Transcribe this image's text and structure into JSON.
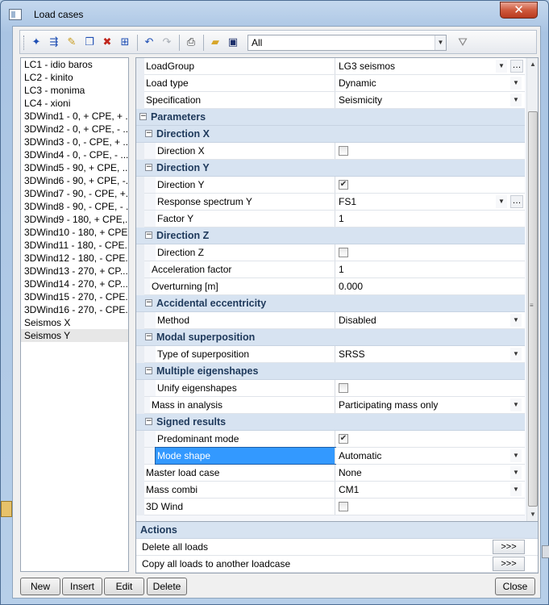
{
  "window": {
    "title": "Load cases",
    "close_glyph": "✕"
  },
  "toolbar": {
    "filter_value": "All",
    "icons": [
      "new-case-icon",
      "insert-icon",
      "edit-icon",
      "copy-icon",
      "delete-icon",
      "tree-icon",
      "undo-icon",
      "redo-icon",
      "print-icon",
      "open-icon",
      "save-icon",
      "filter-icon"
    ]
  },
  "cases": [
    "LC1 - idio  baros",
    "LC2 - kinito",
    "LC3 - monima",
    "LC4 - xioni",
    "3DWind1 - 0, + CPE, + ...",
    "3DWind2 - 0, + CPE, - ...",
    "3DWind3 - 0, - CPE, + ...",
    "3DWind4 - 0, - CPE, - ...",
    "3DWind5 - 90, + CPE, ...",
    "3DWind6 - 90, + CPE, -...",
    "3DWind7 - 90, - CPE, +...",
    "3DWind8 - 90, - CPE, - ...",
    "3DWind9 - 180, + CPE,...",
    "3DWind10 - 180, + CPE...",
    "3DWind11 - 180, - CPE...",
    "3DWind12 - 180, - CPE...",
    "3DWind13 - 270, + CP...",
    "3DWind14 - 270, + CP...",
    "3DWind15 - 270, - CPE...",
    "3DWind16 - 270, - CPE...",
    "Seismos X",
    "Seismos Y"
  ],
  "selected_case_index": 21,
  "properties": [
    {
      "kind": "row",
      "indent": 0,
      "name": "LoadGroup",
      "value": "LG3  seismos",
      "dropdown": true,
      "dots": true
    },
    {
      "kind": "row",
      "indent": 0,
      "name": "Load type",
      "value": "Dynamic",
      "dropdown": true
    },
    {
      "kind": "row",
      "indent": 0,
      "name": "Specification",
      "value": "Seismicity",
      "dropdown": true
    },
    {
      "kind": "section",
      "indent": 0,
      "name": "Parameters"
    },
    {
      "kind": "section",
      "indent": 1,
      "name": "Direction X"
    },
    {
      "kind": "row",
      "indent": 2,
      "name": "Direction X",
      "checkbox": false
    },
    {
      "kind": "section",
      "indent": 1,
      "name": "Direction Y"
    },
    {
      "kind": "row",
      "indent": 2,
      "name": "Direction Y",
      "checkbox": true
    },
    {
      "kind": "row",
      "indent": 2,
      "name": "Response spectrum Y",
      "value": "FS1",
      "dropdown": true,
      "dots": true
    },
    {
      "kind": "row",
      "indent": 2,
      "name": "Factor Y",
      "value": "1"
    },
    {
      "kind": "section",
      "indent": 1,
      "name": "Direction Z"
    },
    {
      "kind": "row",
      "indent": 2,
      "name": "Direction Z",
      "checkbox": false
    },
    {
      "kind": "row",
      "indent": 1,
      "name": "Acceleration factor",
      "value": "1"
    },
    {
      "kind": "row",
      "indent": 1,
      "name": "Overturning [m]",
      "value": "0.000"
    },
    {
      "kind": "section",
      "indent": 1,
      "name": "Accidental eccentricity"
    },
    {
      "kind": "row",
      "indent": 2,
      "name": "Method",
      "value": "Disabled",
      "dropdown": true
    },
    {
      "kind": "section",
      "indent": 1,
      "name": "Modal superposition"
    },
    {
      "kind": "row",
      "indent": 2,
      "name": "Type of superposition",
      "value": "SRSS",
      "dropdown": true
    },
    {
      "kind": "section",
      "indent": 1,
      "name": "Multiple eigenshapes"
    },
    {
      "kind": "row",
      "indent": 2,
      "name": "Unify eigenshapes",
      "checkbox": false
    },
    {
      "kind": "row",
      "indent": 1,
      "name": "Mass in analysis",
      "value": "Participating mass only",
      "dropdown": true
    },
    {
      "kind": "section",
      "indent": 1,
      "name": "Signed results"
    },
    {
      "kind": "row",
      "indent": 2,
      "name": "Predominant mode",
      "checkbox": true
    },
    {
      "kind": "row",
      "indent": 2,
      "name": "Mode shape",
      "value": "Automatic",
      "dropdown": true,
      "highlight": true
    },
    {
      "kind": "row",
      "indent": 0,
      "name": "Master load case",
      "value": "None",
      "dropdown": true
    },
    {
      "kind": "row",
      "indent": 0,
      "name": "Mass combi",
      "value": "CM1",
      "dropdown": true
    },
    {
      "kind": "row",
      "indent": 0,
      "name": "3D Wind",
      "checkbox": false
    }
  ],
  "actions": {
    "title": "Actions",
    "items": [
      {
        "label": "Delete all loads",
        "button": ">>>"
      },
      {
        "label": "Copy all loads to another loadcase",
        "button": ">>>"
      }
    ]
  },
  "buttons": {
    "new": "New",
    "insert": "Insert",
    "edit": "Edit",
    "delete": "Delete",
    "close": "Close"
  }
}
